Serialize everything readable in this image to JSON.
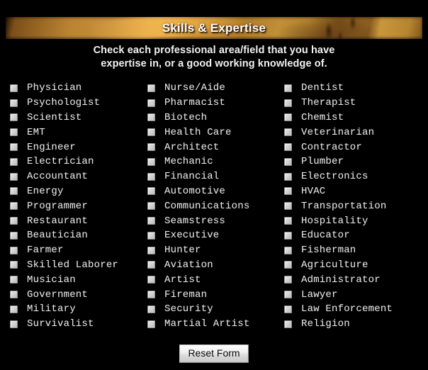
{
  "banner": {
    "title": "Skills & Expertise",
    "accent_color": "#c8903a",
    "title_color": "#ffffff",
    "background_color": "#000000"
  },
  "subtitle": {
    "line1": "Check each professional area/field that you have",
    "line2": "expertise in, or a good working knowledge of.",
    "color": "#f2f2f2"
  },
  "form": {
    "columns": [
      {
        "id": "column-1",
        "items": [
          {
            "label": "Physician",
            "checked": false
          },
          {
            "label": "Psychologist",
            "checked": false
          },
          {
            "label": "Scientist",
            "checked": false
          },
          {
            "label": "EMT",
            "checked": false
          },
          {
            "label": "Engineer",
            "checked": false
          },
          {
            "label": "Electrician",
            "checked": false
          },
          {
            "label": "Accountant",
            "checked": false
          },
          {
            "label": "Energy",
            "checked": false
          },
          {
            "label": "Programmer",
            "checked": false
          },
          {
            "label": "Restaurant",
            "checked": false
          },
          {
            "label": "Beautician",
            "checked": false
          },
          {
            "label": "Farmer",
            "checked": false
          },
          {
            "label": "Skilled Laborer",
            "checked": false
          },
          {
            "label": "Musician",
            "checked": false
          },
          {
            "label": "Government",
            "checked": false
          },
          {
            "label": "Military",
            "checked": false
          },
          {
            "label": "Survivalist",
            "checked": false
          }
        ]
      },
      {
        "id": "column-2",
        "items": [
          {
            "label": "Nurse/Aide",
            "checked": false
          },
          {
            "label": "Pharmacist",
            "checked": false
          },
          {
            "label": "Biotech",
            "checked": false
          },
          {
            "label": "Health Care",
            "checked": false
          },
          {
            "label": "Architect",
            "checked": false
          },
          {
            "label": "Mechanic",
            "checked": false
          },
          {
            "label": "Financial",
            "checked": false
          },
          {
            "label": "Automotive",
            "checked": false
          },
          {
            "label": "Communications",
            "checked": false
          },
          {
            "label": "Seamstress",
            "checked": false
          },
          {
            "label": "Executive",
            "checked": false
          },
          {
            "label": "Hunter",
            "checked": false
          },
          {
            "label": "Aviation",
            "checked": false
          },
          {
            "label": "Artist",
            "checked": false
          },
          {
            "label": "Fireman",
            "checked": false
          },
          {
            "label": "Security",
            "checked": false
          },
          {
            "label": "Martial Artist",
            "checked": false
          }
        ]
      },
      {
        "id": "column-3",
        "items": [
          {
            "label": "Dentist",
            "checked": false
          },
          {
            "label": "Therapist",
            "checked": false
          },
          {
            "label": "Chemist",
            "checked": false
          },
          {
            "label": "Veterinarian",
            "checked": false
          },
          {
            "label": "Contractor",
            "checked": false
          },
          {
            "label": "Plumber",
            "checked": false
          },
          {
            "label": "Electronics",
            "checked": false
          },
          {
            "label": "HVAC",
            "checked": false
          },
          {
            "label": "Transportation",
            "checked": false
          },
          {
            "label": "Hospitality",
            "checked": false
          },
          {
            "label": "Educator",
            "checked": false
          },
          {
            "label": "Fisherman",
            "checked": false
          },
          {
            "label": "Agriculture",
            "checked": false
          },
          {
            "label": "Administrator",
            "checked": false
          },
          {
            "label": "Lawyer",
            "checked": false
          },
          {
            "label": "Law Enforcement",
            "checked": false
          },
          {
            "label": "Religion",
            "checked": false
          }
        ]
      }
    ],
    "reset_button_label": "Reset Form"
  }
}
